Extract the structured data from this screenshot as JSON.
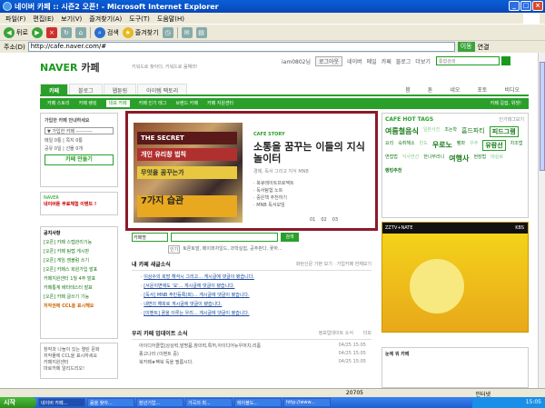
{
  "window": {
    "title": "네이버 카페 :: 시즌2 오픈! - Microsoft Internet Explorer"
  },
  "menu": [
    "파일(F)",
    "편집(E)",
    "보기(V)",
    "즐겨찾기(A)",
    "도구(T)",
    "도움말(H)"
  ],
  "toolbar": {
    "back": "뒤로",
    "search": "검색",
    "favorites": "즐겨찾기"
  },
  "address": {
    "label": "주소(D)",
    "url": "http://cafe.naver.com/#",
    "go": "이동",
    "links": "연결"
  },
  "header": {
    "logo_naver": "NAVER",
    "logo_cafe": "카페",
    "tagline": "키워드로 찾아더, 키워드로 움해라!",
    "user": "iam0802님",
    "logout": "로그아웃",
    "links": [
      "네이버",
      "메일",
      "카페",
      "블로그",
      "더보기"
    ],
    "search_placeholder": "통합검색"
  },
  "nav_tabs": [
    "카페",
    "블로그",
    "웹툰링",
    "아이템 팩토리"
  ],
  "nav_right": [
    "붐",
    "톤",
    "네오",
    "포토",
    "비디오"
  ],
  "subnav": [
    "카페 스토리",
    "카페 랭킹",
    "대표 카페",
    "카페 인기 태그",
    "브랜드 카페",
    "카페 지원센터"
  ],
  "subnav_right": "카페 길잡, 위젯!",
  "login_box": {
    "title": "가입한 카페 안내하세요",
    "select": "▼ 가입한 카페 ----------",
    "mail": "메일 0통",
    "note": "쪽지 0통",
    "cafe": "공유 0일",
    "gift": "선물 0개",
    "make": "카페 만들기"
  },
  "promo": {
    "brand": "NAVER",
    "text": "네이버툰 무료체험 이벤트 !"
  },
  "notice": {
    "title": "공지사항",
    "more": "더보기",
    "items": [
      "[오픈] 카페 스텝관리기능",
      "[오픈] 카페 팀랩 게시판",
      "[오픈] 게임 엠블럼 쓰기",
      "[오픈] 카페스 회원가입 발표",
      "카페지원센터 1월 4주 발표",
      "카페통계 베타테스터 발표",
      "[오픈] 카페 글쓰기 기능"
    ],
    "ccl": "저작권에 CCL을 표시해요"
  },
  "help": {
    "line1": "창작과 나눔이 있는 열린 문화",
    "line2": "저작물에 CCL을 표시하세요",
    "support": "카페지원센터",
    "report": "마로카페 알리드리오!"
  },
  "feature": {
    "kicker": "CAFE STORY",
    "headline": "소통을 꿈꾸는 이들의 지식 놀이터",
    "sub": "경제, 독서 그리고 지식 MNB",
    "bullets": [
      "북큐레이트프로젝트",
      "독서탐험 노트",
      "중은책 추천하기",
      "MNB 독서모임"
    ],
    "books": [
      "THE SECRET",
      "개인 유리창 법칙",
      "무엇을 꿈꾸는가",
      "7가지 습관"
    ],
    "pager": [
      "01",
      "02",
      "03"
    ]
  },
  "hottags": {
    "title": "CAFE HOT TAGS",
    "more": "인기태그보기",
    "tags": [
      "여름철음식",
      "일본사진",
      "조논학",
      "홈드파티",
      "피드그램",
      "요리",
      "숙취해소",
      "반도",
      "우로노",
      "팸파",
      "우주",
      "유람선",
      "차조법",
      "면접법",
      "익사연선",
      "한나무라니",
      "여행사",
      "현장법",
      "태실로"
    ],
    "hot": "랭킹추천"
  },
  "ad": {
    "top": "ZZTV+NATE",
    "kbs": "KBS"
  },
  "center_search": {
    "select": "카페명",
    "button": "검색"
  },
  "popular": {
    "label": "인기",
    "text": "토론토발, 페이퍼차일드, 과학실험, 공주판다, 꽃하..."
  },
  "my_cafe": {
    "title": "내 카페 새글소식",
    "opts": "화탄신문 가본 보기 · 가입카페 전체보기",
    "items": [
      "이상수의 희망 해석시 그리고... 게시글에 댓글이 됐습니다.",
      "[서운이면에도 '요'... 게시글에 댓글이 됐습니다.",
      "[독서] MNB 주민등록(회)... 게시글에 댓글이 됐습니다.",
      "내면의 해회로 게시글에 댓글이 됐습니다.",
      "[이벤트] 꿈을 이루는 우리... 게시글에 댓글이 됐습니다."
    ]
  },
  "update": {
    "title": "우리 카페 업데이트 소식",
    "sub": "정보업데이트 소식",
    "more": "더보",
    "rows": [
      {
        "t": "아이디어클럽[상상력,발명품,창의력,특허,아이디어뉴우머치,리폼",
        "d": "04/25 15:05"
      },
      {
        "t": "종고나라 (이벤트 중)",
        "d": "04/25 15:05"
      },
      {
        "t": "북카페★팩북 독을 필름시다.",
        "d": "04/25 15:05"
      }
    ]
  },
  "popbox": "눈에 뭐 카페",
  "status": {
    "text": "",
    "zoom": "20705",
    "zone": "인터넷"
  },
  "taskbar": {
    "start": "시작",
    "tasks": [
      "네이버 카페...",
      "음을 찾아...",
      "장년기업...",
      "가곡의 최...",
      "레이블도...",
      "http://www..."
    ],
    "clock": "15:05"
  }
}
